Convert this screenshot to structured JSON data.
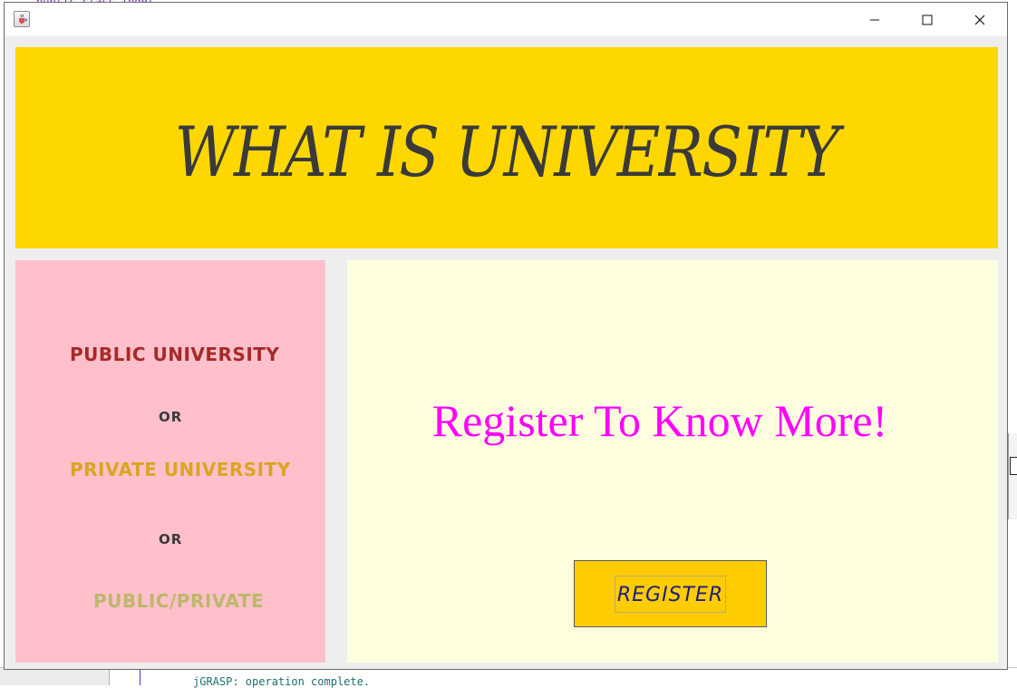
{
  "background": {
    "ide_code_fragment": "public class Indet",
    "ide_bottom_text": "jGRASP: operation complete."
  },
  "window": {
    "app_icon": "java-coffee-icon",
    "controls": {
      "minimize_icon": "minimize-icon",
      "maximize_icon": "maximize-icon",
      "close_icon": "close-icon"
    }
  },
  "header": {
    "title": "WHAT IS UNIVERSITY",
    "background_color": "#ffd700"
  },
  "options": {
    "public": "PUBLIC UNIVERSITY",
    "or1": "OR",
    "private": "PRIVATE UNIVERSITY",
    "or2": "OR",
    "public_private": "PUBLIC/PRIVATE",
    "background_color": "#ffc0cb"
  },
  "register_panel": {
    "message": "Register To Know More!",
    "button_label": "REGISTER",
    "background_color": "#ffffe0",
    "message_color": "#ff00ff",
    "button_color": "#ffcc00"
  }
}
